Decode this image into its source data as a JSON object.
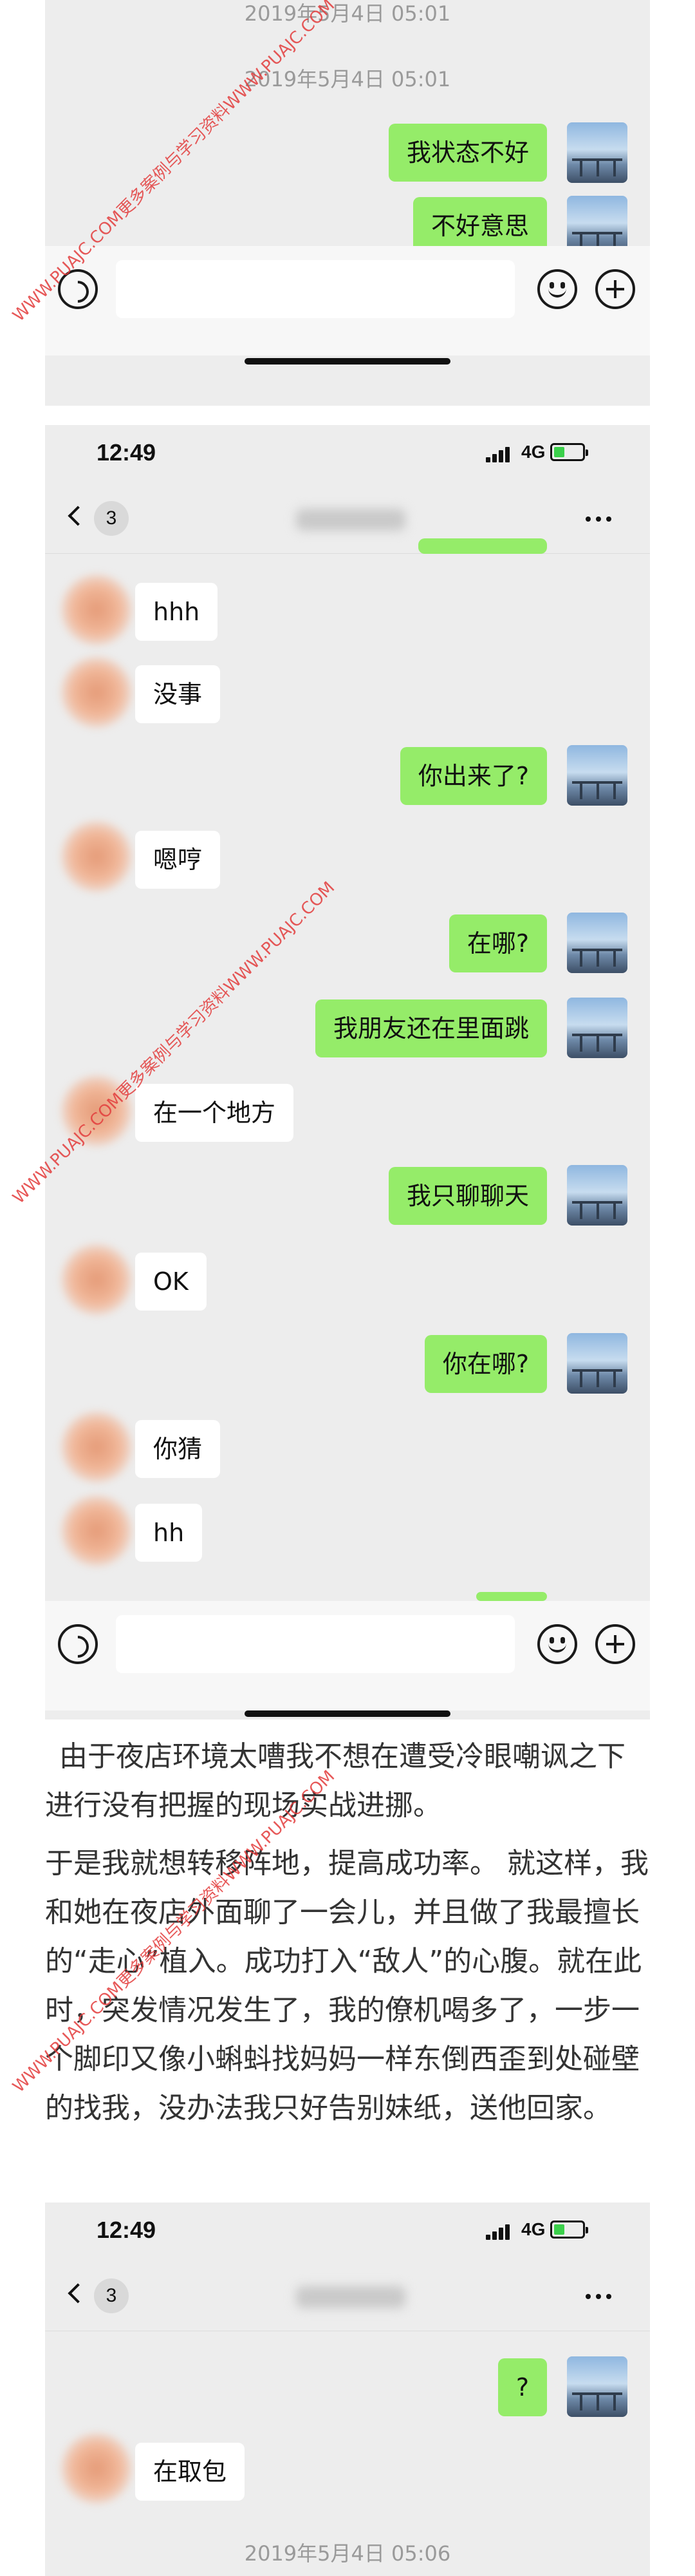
{
  "screens": [
    {
      "timestamps": [
        "2019年5月4日 05:01",
        "2019年5月4日 05:01"
      ],
      "messages": [
        {
          "side": "right",
          "text": "我状态不好"
        },
        {
          "side": "right",
          "text": "不好意思"
        }
      ]
    },
    {
      "status": {
        "time": "12:49",
        "network": "4G"
      },
      "nav": {
        "back_count": "3"
      },
      "messages": [
        {
          "side": "left",
          "text": "hhh"
        },
        {
          "side": "left",
          "text": "没事"
        },
        {
          "side": "right",
          "text": "你出来了?"
        },
        {
          "side": "left",
          "text": "嗯哼"
        },
        {
          "side": "right",
          "text": "在哪?"
        },
        {
          "side": "right",
          "text": "我朋友还在里面跳"
        },
        {
          "side": "left",
          "text": "在一个地方"
        },
        {
          "side": "right",
          "text": "我只聊聊天"
        },
        {
          "side": "left",
          "text": "OK"
        },
        {
          "side": "right",
          "text": "你在哪?"
        },
        {
          "side": "left",
          "text": "你猜"
        },
        {
          "side": "left",
          "text": "hh"
        }
      ]
    },
    {
      "status": {
        "time": "12:49",
        "network": "4G"
      },
      "nav": {
        "back_count": "3"
      },
      "messages": [
        {
          "side": "right",
          "text": "?"
        },
        {
          "side": "left",
          "text": "在取包"
        }
      ],
      "timestamp": "2019年5月4日 05:06"
    }
  ],
  "article": {
    "paragraph1": "由于夜店环境太嘈我不想在遭受冷眼嘲讽之下进行没有把握的现场实战进挪。",
    "paragraph2": "于是我就想转移阵地，提高成功率。 就这样，我和她在夜店外面聊了一会儿，并且做了我最擅长的“走心”植入。成功打入“敌人”的心腹。就在此时，突发情况发生了，我的僚机喝多了，一步一个脚印又像小蝌蚪找妈妈一样东倒西歪到处碰壁的找我，没办法我只好告别妹纸，送他回家。"
  },
  "watermark": "WWW.PUAJC.COM更多案例与学习资料WWW.PUAJC.COM",
  "colors": {
    "bubble_right": "#95ec69",
    "bubble_left": "#ffffff",
    "chat_bg": "#ededed",
    "watermark": "#e33c3c"
  }
}
